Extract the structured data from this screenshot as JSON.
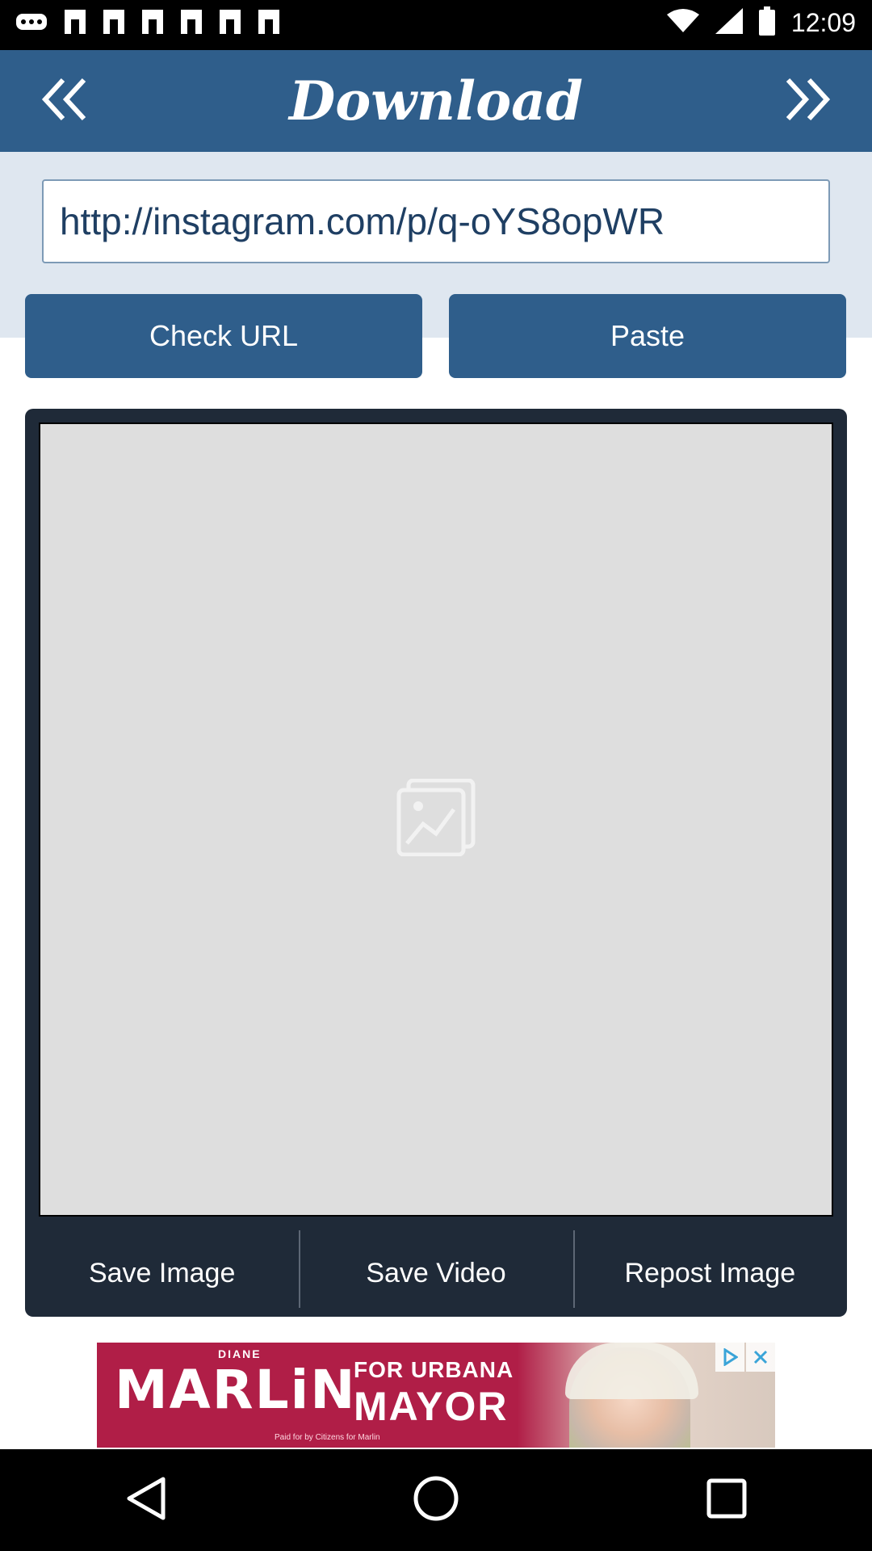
{
  "status_bar": {
    "time": "12:09",
    "icons": [
      "more-icon",
      "instagram-notification-icon",
      "instagram-notification-icon",
      "instagram-notification-icon",
      "instagram-notification-icon",
      "instagram-notification-icon",
      "instagram-notification-icon",
      "wifi-icon",
      "signal-icon",
      "battery-icon"
    ]
  },
  "header": {
    "title": "Download",
    "back_icon": "double-chevron-left-icon",
    "forward_icon": "double-chevron-right-icon"
  },
  "url_input": {
    "value": "http://instagram.com/p/q-oYS8opWR"
  },
  "buttons": {
    "check_url": "Check URL",
    "paste": "Paste"
  },
  "preview": {
    "placeholder_icon": "image-placeholder-icon"
  },
  "actions": {
    "save_image": "Save Image",
    "save_video": "Save Video",
    "repost_image": "Repost Image"
  },
  "ad": {
    "small_text": "DIANE",
    "name": "MARLiN",
    "line1": "FOR URBANA",
    "line2": "MAYOR",
    "fine_print": "Paid for by Citizens for Marlin",
    "adchoices_icon": "adchoices-icon",
    "close_icon": "close-icon"
  },
  "colors": {
    "header": "#2f5e8b",
    "url_band": "#dfe7f0",
    "card": "#1f2a38",
    "ad": "#b01e47"
  }
}
